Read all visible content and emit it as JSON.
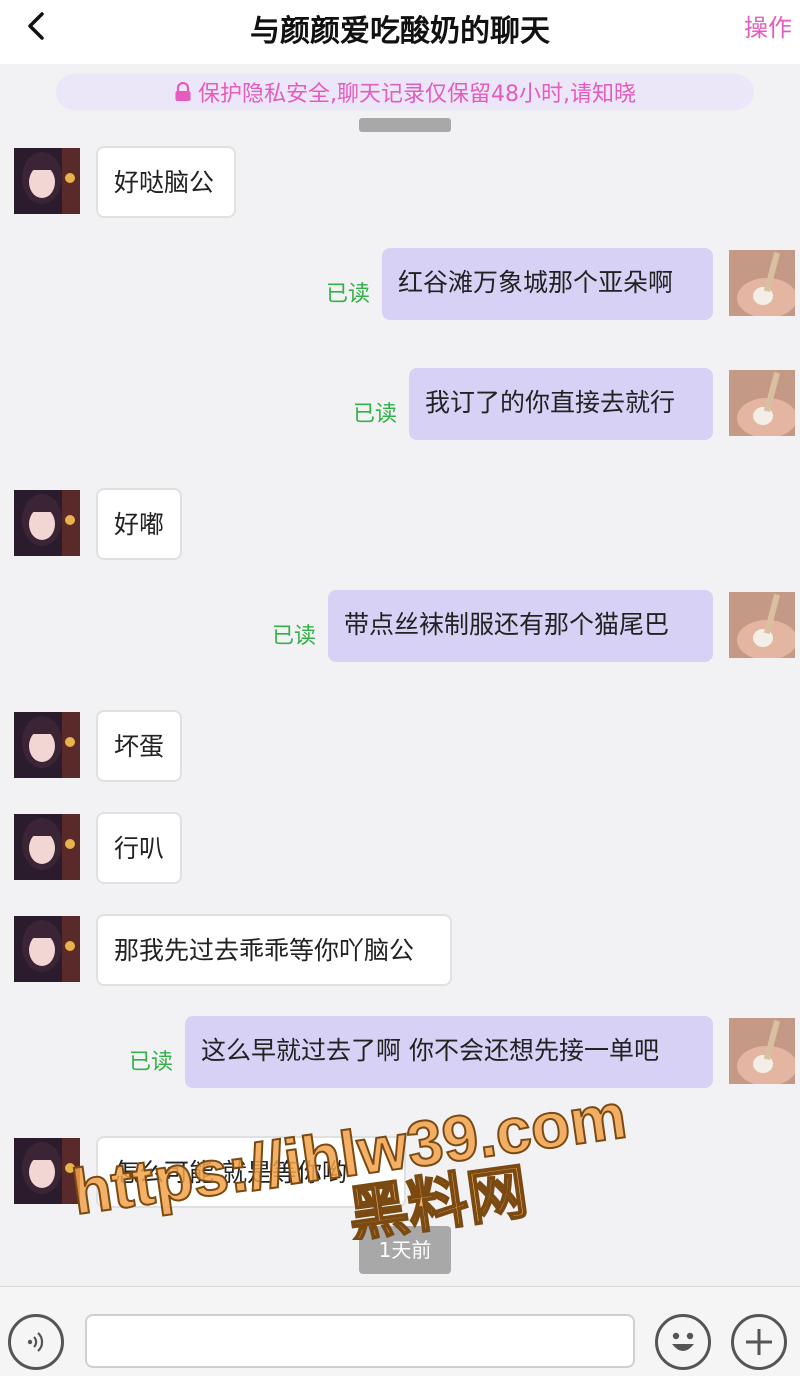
{
  "header": {
    "title": "与颜颜爱吃酸奶的聊天",
    "action": "操作"
  },
  "notice": "保护隐私安全,聊天记录仅保留48小时,请知晓",
  "messages": [
    {
      "side": "in",
      "text": "好哒脑公"
    },
    {
      "side": "out",
      "text": "红谷滩万象城那个亚朵啊",
      "status": "已读"
    },
    {
      "side": "out",
      "text": "我订了的你直接去就行",
      "status": "已读"
    },
    {
      "side": "in",
      "text": "好嘟"
    },
    {
      "side": "out",
      "text": "带点丝袜制服还有那个猫尾巴",
      "status": "已读"
    },
    {
      "side": "in",
      "text": "坏蛋"
    },
    {
      "side": "in",
      "text": "行叭"
    },
    {
      "side": "in",
      "text": "那我先过去乖乖等你吖脑公"
    },
    {
      "side": "out",
      "text": "这么早就过去了啊 你不会还想先接一单吧",
      "status": "已读"
    },
    {
      "side": "in",
      "text": "怎么可能 就是等你哟"
    }
  ],
  "time_chip": "1天前",
  "watermark": {
    "line1": "https://ihlw39.com",
    "line2": "黑料网"
  },
  "input": {
    "placeholder": ""
  },
  "colors": {
    "accent": "#e65bbd",
    "outgoing_bubble": "#d7d2f5",
    "read_status": "#31b148",
    "notice_bg": "#ece7f8"
  },
  "icons": {
    "back": "chevron-left-icon",
    "lock": "lock-icon",
    "voice": "voice-icon",
    "emoji": "emoji-icon",
    "plus": "plus-icon"
  }
}
